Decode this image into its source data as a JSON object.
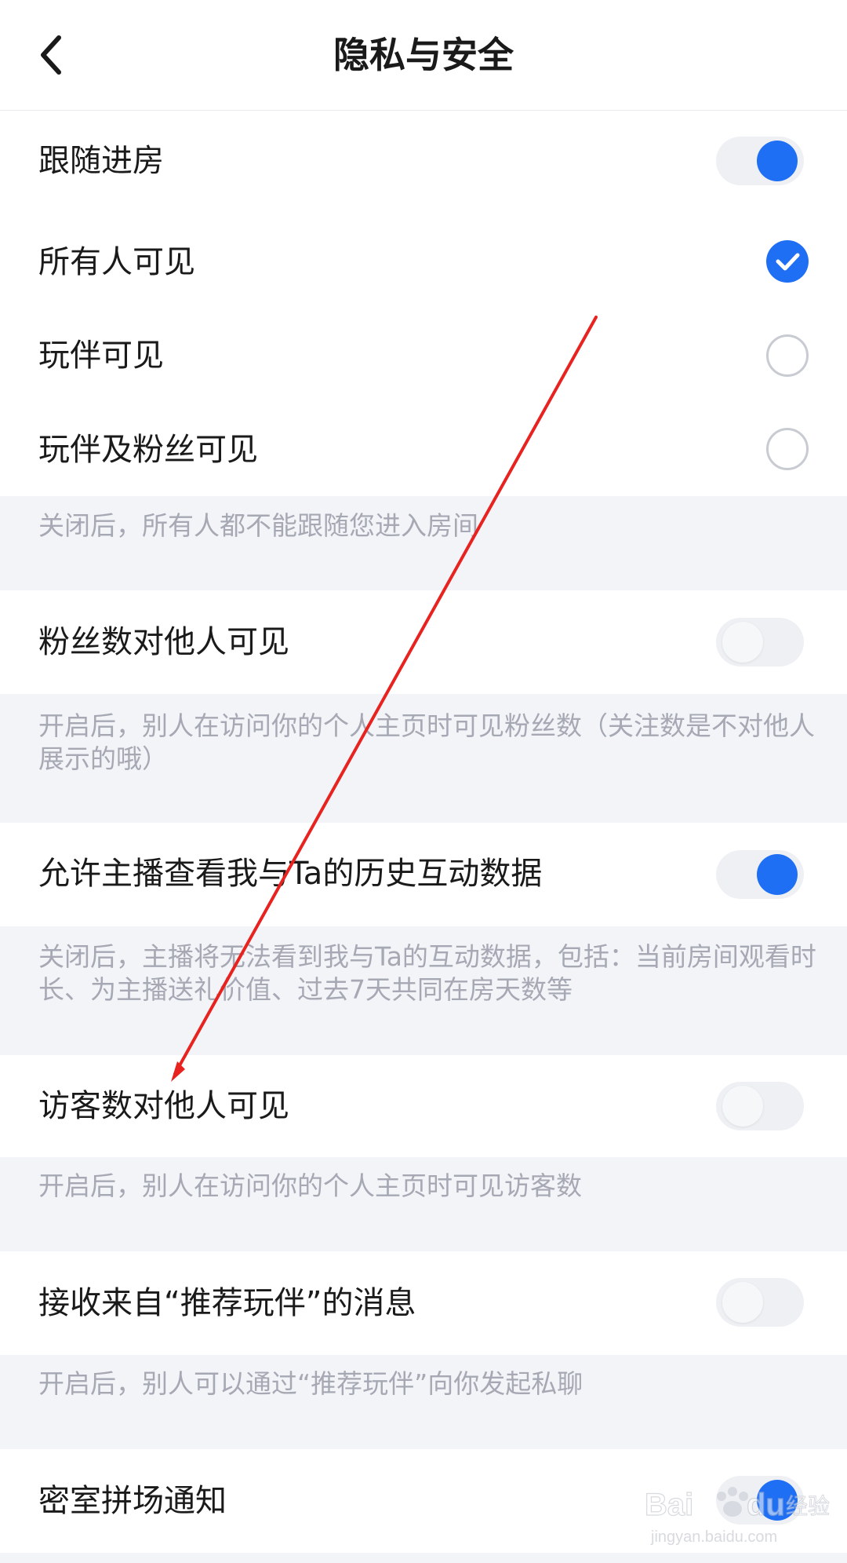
{
  "header": {
    "title": "隐私与安全",
    "back_icon": "chevron-left-icon"
  },
  "follow_room": {
    "label": "跟随进房",
    "enabled": true,
    "options": [
      {
        "label": "所有人可见",
        "selected": true
      },
      {
        "label": "玩伴可见",
        "selected": false
      },
      {
        "label": "玩伴及粉丝可见",
        "selected": false
      }
    ],
    "note": "关闭后，所有人都不能跟随您进入房间"
  },
  "fans_visible": {
    "label": "粉丝数对他人可见",
    "enabled": false,
    "note": "开启后，别人在访问你的个人主页时可见粉丝数（关注数是不对他人展示的哦）"
  },
  "interaction_data": {
    "label": "允许主播查看我与Ta的历史互动数据",
    "enabled": true,
    "note": "关闭后，主播将无法看到我与Ta的互动数据，包括：当前房间观看时长、为主播送礼价值、过去7天共同在房天数等"
  },
  "visitors_visible": {
    "label": "访客数对他人可见",
    "enabled": false,
    "note": "开启后，别人在访问你的个人主页时可见访客数"
  },
  "recommend_msgs": {
    "label": "接收来自“推荐玩伴”的消息",
    "enabled": false,
    "note": "开启后，别人可以通过“推荐玩伴”向你发起私聊"
  },
  "escape_room": {
    "label": "密室拼场通知",
    "enabled": true
  },
  "colors": {
    "accent": "#1f6ff5",
    "note_text": "#a6a9b4",
    "section_bg": "#f3f4f8",
    "annotation": "#e8231f"
  },
  "watermark": {
    "brand": "Baidu经验",
    "url": "jingyan.baidu.com"
  }
}
